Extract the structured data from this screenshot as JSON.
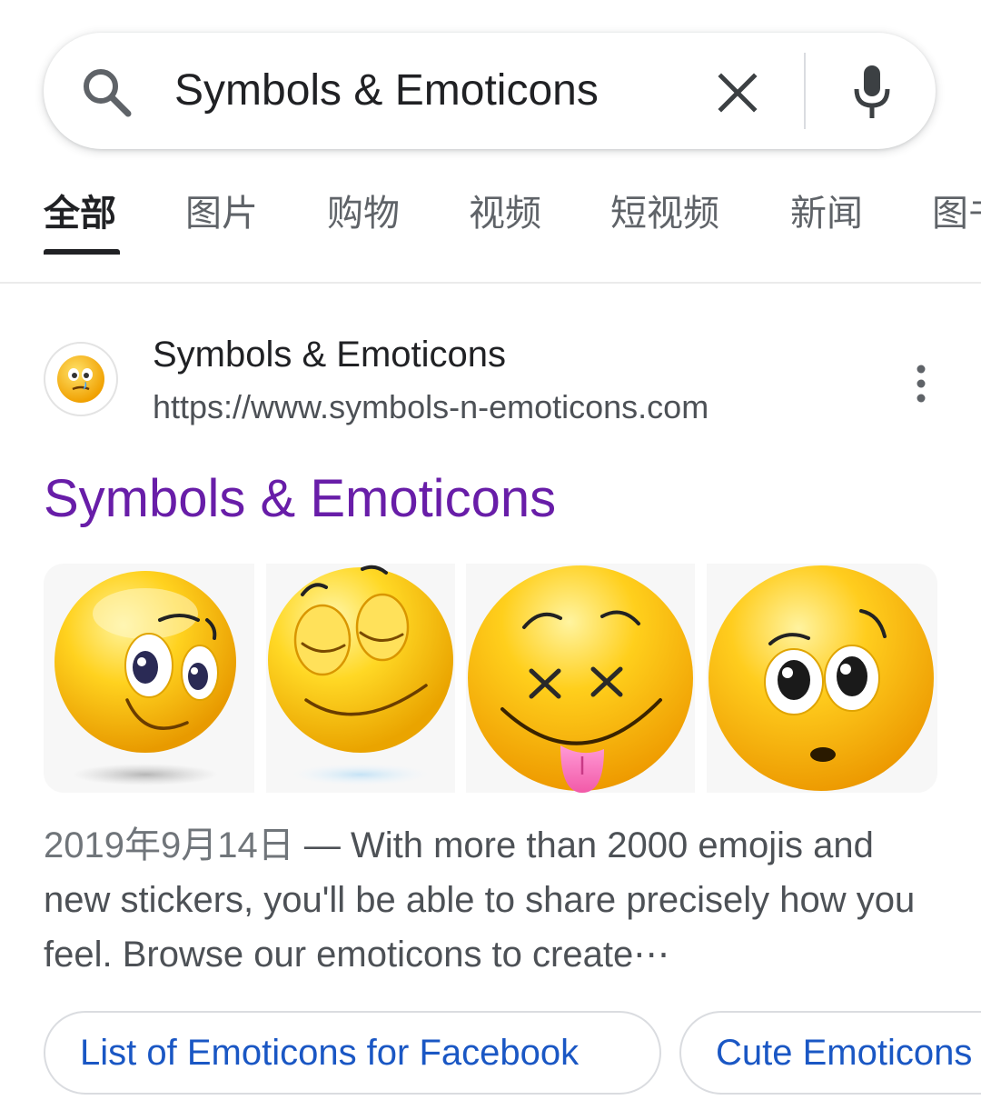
{
  "search": {
    "query": "Symbols & Emoticons"
  },
  "tabs": [
    {
      "label": "全部",
      "active": true
    },
    {
      "label": "图片"
    },
    {
      "label": "购物"
    },
    {
      "label": "视频"
    },
    {
      "label": "短视频"
    },
    {
      "label": "新闻"
    },
    {
      "label": "图书"
    }
  ],
  "result": {
    "site_name": "Symbols & Emoticons",
    "url": "https://www.symbols-n-emoticons.com",
    "title": "Symbols & Emoticons",
    "images": [
      {
        "icon": "smiley-looking-sideways-icon"
      },
      {
        "icon": "smiley-eyes-closed-icon"
      },
      {
        "icon": "smiley-dizzy-tongue-out-icon"
      },
      {
        "icon": "smiley-surprised-icon"
      }
    ],
    "date": "2019年9月14日",
    "separator": " — ",
    "snippet": "With more than 2000 emojis and new stickers, you'll be able to share precisely how you feel. Browse our emoticons to create⋯",
    "chips": [
      {
        "label": "List of Emoticons for Facebook"
      },
      {
        "label": "Cute Emoticons"
      }
    ]
  },
  "colors": {
    "visited_link": "#681da8",
    "chip_text": "#1a57c4",
    "emoji_yellow": "#f7c31d",
    "emoji_orange": "#f0a000"
  }
}
